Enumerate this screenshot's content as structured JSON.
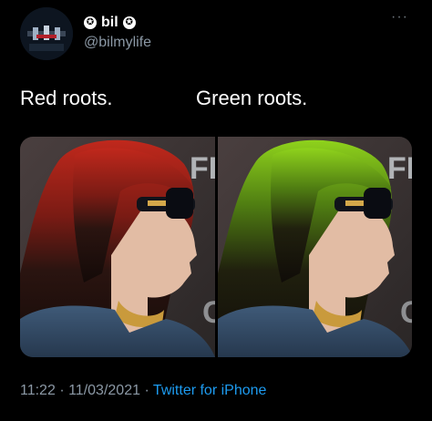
{
  "user": {
    "display_name": "bil",
    "handle": "@bilmylife",
    "badge_icon": "star-badge-icon"
  },
  "menu": {
    "more_label": "···"
  },
  "captions": {
    "left": "Red roots.",
    "right": "Green roots."
  },
  "media": {
    "left_root_color": "#c0281c",
    "right_root_color": "#8fd21c"
  },
  "meta": {
    "time": "11:22",
    "separator": "·",
    "date": "11/03/2021",
    "source": "Twitter for iPhone"
  }
}
